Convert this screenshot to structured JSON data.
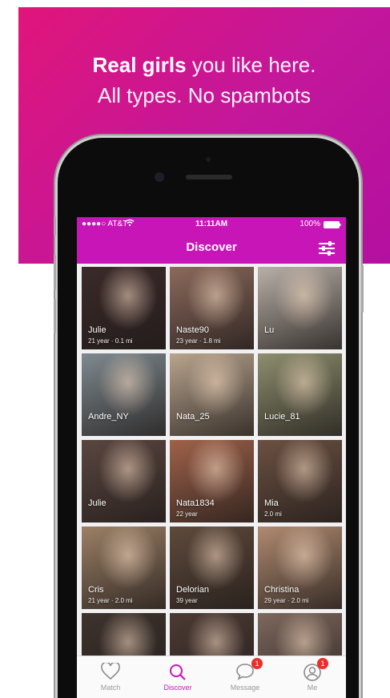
{
  "promo": {
    "headline_bold": "Real girls",
    "headline_rest": "you like here.",
    "headline_line2": "All types. No spambots"
  },
  "status_bar": {
    "carrier": "●●●●○ AT&T",
    "time": "11:11AM",
    "battery": "100%"
  },
  "navbar": {
    "title": "Discover",
    "filter_icon": "sliders-icon"
  },
  "profiles": [
    {
      "name": "Julie",
      "meta": "21 year · 0.1 mi",
      "color": "#3b2a2a"
    },
    {
      "name": "Naste90",
      "meta": "23 year · 1.8 mi",
      "color": "#8c6a5c"
    },
    {
      "name": "Lu",
      "meta": "",
      "color": "#b8b0a8"
    },
    {
      "name": "Andre_NY",
      "meta": "",
      "color": "#7f8a90"
    },
    {
      "name": "Nata_25",
      "meta": "",
      "color": "#b9a58e"
    },
    {
      "name": "Lucie_81",
      "meta": "",
      "color": "#8d8f6f"
    },
    {
      "name": "Julie",
      "meta": "",
      "color": "#5a4640"
    },
    {
      "name": "Nata1834",
      "meta": "22 year",
      "color": "#a0624a"
    },
    {
      "name": "Mia",
      "meta": "2.0 mi",
      "color": "#6b5142"
    },
    {
      "name": "Cris",
      "meta": "21 year · 2.0 mi",
      "color": "#9c8066"
    },
    {
      "name": "Delorian",
      "meta": "39 year",
      "color": "#5f4a3c"
    },
    {
      "name": "Christina",
      "meta": "29 year · 2.0 mi",
      "color": "#b08a70"
    },
    {
      "name": "",
      "meta": "",
      "color": "#3e332e"
    },
    {
      "name": "",
      "meta": "",
      "color": "#4c3a34"
    },
    {
      "name": "",
      "meta": "",
      "color": "#7d685d"
    }
  ],
  "tabs": [
    {
      "label": "Match",
      "icon": "heart-icon",
      "active": false,
      "badge": ""
    },
    {
      "label": "Discover",
      "icon": "search-icon",
      "active": true,
      "badge": ""
    },
    {
      "label": "Message",
      "icon": "chat-bubble-icon",
      "active": false,
      "badge": "1"
    },
    {
      "label": "Me",
      "icon": "profile-icon",
      "active": false,
      "badge": "1"
    }
  ],
  "colors": {
    "brand": "#c815b8",
    "badge": "#e8302b"
  }
}
